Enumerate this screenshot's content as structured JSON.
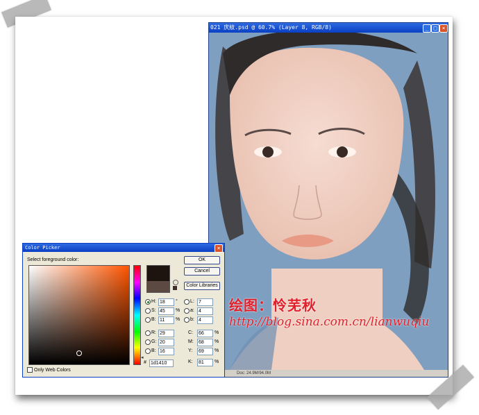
{
  "document": {
    "title": "021 庆紋.psd @ 60.7% (Layer 8, RGB/8)",
    "status": "Doc: 24.9M/94.0M"
  },
  "watermark": {
    "line1": "绘图：怜芜秋",
    "line2": "http://blog.sina.com.cn/lianwuqiu"
  },
  "color_picker": {
    "title": "Color Picker",
    "prompt": "Select foreground color:",
    "buttons": {
      "ok": "OK",
      "cancel": "Cancel",
      "libraries": "Color Libraries"
    },
    "hsb": [
      {
        "label": "H:",
        "value": "18",
        "unit": "°"
      },
      {
        "label": "S:",
        "value": "45",
        "unit": "%"
      },
      {
        "label": "B:",
        "value": "11",
        "unit": "%"
      }
    ],
    "rgb": [
      {
        "label": "R:",
        "value": "29"
      },
      {
        "label": "G:",
        "value": "20"
      },
      {
        "label": "B:",
        "value": "16"
      }
    ],
    "lab": [
      {
        "label": "L:",
        "value": "7"
      },
      {
        "label": "a:",
        "value": "4"
      },
      {
        "label": "b:",
        "value": "4"
      }
    ],
    "cmyk": [
      {
        "label": "C:",
        "value": "66",
        "unit": "%"
      },
      {
        "label": "M:",
        "value": "68",
        "unit": "%"
      },
      {
        "label": "Y:",
        "value": "69",
        "unit": "%"
      },
      {
        "label": "K:",
        "value": "81",
        "unit": "%"
      }
    ],
    "hex_label": "#",
    "hex": "1d1410",
    "web_only_label": "Only Web Colors",
    "colors": {
      "new": "#1d1410",
      "current": "#5c4a42",
      "base_hue": "#ff5500"
    }
  },
  "icons": [
    "minimize-icon",
    "maximize-icon",
    "close-icon",
    "gamut-warning-icon"
  ]
}
